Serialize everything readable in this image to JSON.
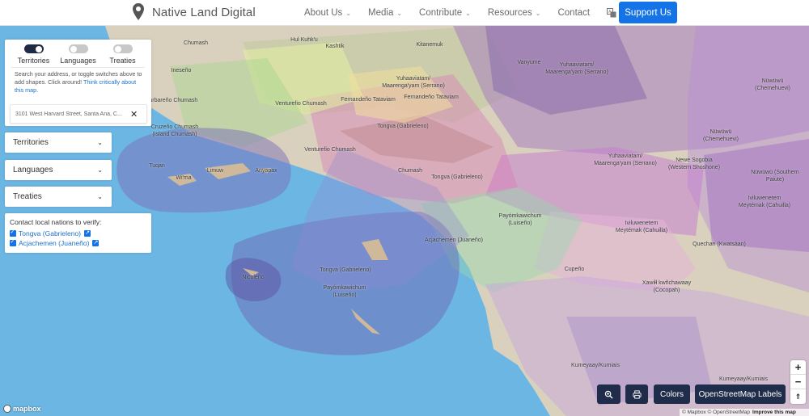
{
  "header": {
    "brand": "Native Land Digital",
    "nav": [
      {
        "label": "About Us",
        "has_dropdown": true
      },
      {
        "label": "Media",
        "has_dropdown": true
      },
      {
        "label": "Contribute",
        "has_dropdown": true
      },
      {
        "label": "Resources",
        "has_dropdown": true
      },
      {
        "label": "Contact",
        "has_dropdown": false
      }
    ],
    "language_icon": "translate-icon",
    "support_label": "Support Us",
    "accent_color": "#1473e6"
  },
  "panel": {
    "toggles": [
      {
        "label": "Territories",
        "on": true
      },
      {
        "label": "Languages",
        "on": false
      },
      {
        "label": "Treaties",
        "on": false
      }
    ],
    "help_text": "Search your address, or toggle switches above to add shapes. Click around!",
    "help_link": "Think critically about this map.",
    "search_value": "3101 West Harvard Street, Santa Ana, C..."
  },
  "dropdowns": {
    "territories": "Territories",
    "languages": "Languages",
    "treaties": "Treaties"
  },
  "contact": {
    "title": "Contact local nations to verify:",
    "nations": [
      {
        "label": "Tongva (Gabrieleno)",
        "checked": true
      },
      {
        "label": "Acjachemen (Juaneño)",
        "checked": true
      }
    ]
  },
  "map_labels": [
    "Chumash",
    "Hul Kuhk'u",
    "Kashtik",
    "Kitanemuk",
    "Vanyume",
    "Yuhaaviatam/\nMaarenga'yam (Serrano)",
    "Nüwüwü\n(Chemehuevi)",
    "Ineseño",
    "Barbareño Chumash",
    "Venturefio Chumash",
    "Fernandeño Tataviam",
    "Fernandeño Tataviam",
    "Yuhaaviatam/\nMaarenga'yam (Serrano)",
    "Tongva (Gabrieleno)",
    "Cruzeño Chumash\n(Island Chumash)",
    "Nüwüwü\n(Chemehuevi)",
    "Venturefio Chumash",
    "Yuhaaviatam/\nMaarenga'yam (Serrano)",
    "Newe Sogobia\n(Western Shoshone)",
    "Tuqan",
    "Wi'ma",
    "Limuw",
    "Anyapax",
    "Chumash",
    "Tongva (Gabrieleno)",
    "Nüwüwü (Southern\nPaiute)",
    "Iviluwenetem\nMeytémak (Cahuilla)",
    "Payómkawichum\n(Luiseño)",
    "Iviluwenetem\nMeytémak (Cahuilla)",
    "Quechan (Kwatsáan)",
    "Acjachemen (Juaneño)",
    "Nicoleño",
    "Tongva (Gabrieleno)",
    "Payómkawichum\n(Luiseño)",
    "Cupeño",
    "Xawiłł kwñchawaay\n(Cocopah)",
    "Kumeyaay/Kumiais",
    "Kumeyaay/Kumiais"
  ],
  "controls": {
    "zoom_search_icon": "zoom-search-icon",
    "print_icon": "print-icon",
    "colors_label": "Colors",
    "osm_label": "OpenStreetMap Labels",
    "zoom_in": "+",
    "zoom_out": "−",
    "compass": "⇑"
  },
  "attribution": {
    "text": "© Mapbox © OpenStreetMap",
    "improve": "Improve this map",
    "mapbox_logo": "mapbox"
  }
}
